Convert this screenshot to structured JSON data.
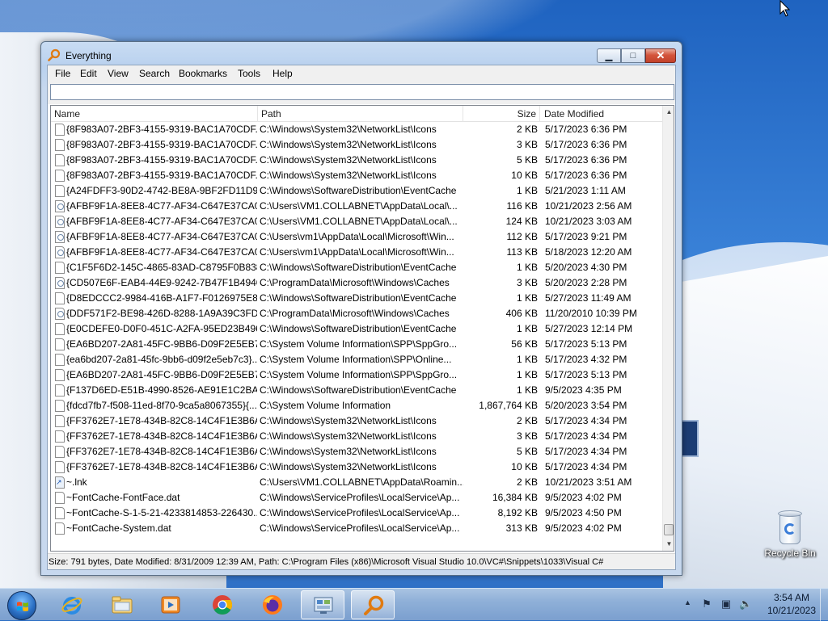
{
  "window": {
    "title": "Everything",
    "caption": {
      "minimize": "▁",
      "maximize": "□",
      "close": "✕"
    }
  },
  "menu": [
    "File",
    "Edit",
    "View",
    "Search",
    "Bookmarks",
    "Tools",
    "Help"
  ],
  "search": {
    "value": "",
    "placeholder": ""
  },
  "columns": {
    "name": "Name",
    "path": "Path",
    "size": "Size",
    "date": "Date Modified"
  },
  "rows": [
    {
      "icon": "file-icon",
      "name": "{8F983A07-2BF3-4155-9319-BAC1A70CDF...",
      "path": "C:\\Windows\\System32\\NetworkList\\Icons",
      "size": "2 KB",
      "date": "5/17/2023 6:36 PM"
    },
    {
      "icon": "file-icon",
      "name": "{8F983A07-2BF3-4155-9319-BAC1A70CDF...",
      "path": "C:\\Windows\\System32\\NetworkList\\Icons",
      "size": "3 KB",
      "date": "5/17/2023 6:36 PM"
    },
    {
      "icon": "file-icon",
      "name": "{8F983A07-2BF3-4155-9319-BAC1A70CDF...",
      "path": "C:\\Windows\\System32\\NetworkList\\Icons",
      "size": "5 KB",
      "date": "5/17/2023 6:36 PM"
    },
    {
      "icon": "file-icon",
      "name": "{8F983A07-2BF3-4155-9319-BAC1A70CDF...",
      "path": "C:\\Windows\\System32\\NetworkList\\Icons",
      "size": "10 KB",
      "date": "5/17/2023 6:36 PM"
    },
    {
      "icon": "file-icon",
      "name": "{A24FDFF3-90D2-4742-BE8A-9BF2FD11D9...",
      "path": "C:\\Windows\\SoftwareDistribution\\EventCache",
      "size": "1 KB",
      "date": "5/21/2023 1:11 AM"
    },
    {
      "icon": "image-file-icon",
      "name": "{AFBF9F1A-8EE8-4C77-AF34-C647E37CA0...",
      "path": "C:\\Users\\VM1.COLLABNET\\AppData\\Local\\...",
      "size": "116 KB",
      "date": "10/21/2023 2:56 AM"
    },
    {
      "icon": "image-file-icon",
      "name": "{AFBF9F1A-8EE8-4C77-AF34-C647E37CA0...",
      "path": "C:\\Users\\VM1.COLLABNET\\AppData\\Local\\...",
      "size": "124 KB",
      "date": "10/21/2023 3:03 AM"
    },
    {
      "icon": "image-file-icon",
      "name": "{AFBF9F1A-8EE8-4C77-AF34-C647E37CA0...",
      "path": "C:\\Users\\vm1\\AppData\\Local\\Microsoft\\Win...",
      "size": "112 KB",
      "date": "5/17/2023 9:21 PM"
    },
    {
      "icon": "image-file-icon",
      "name": "{AFBF9F1A-8EE8-4C77-AF34-C647E37CA0...",
      "path": "C:\\Users\\vm1\\AppData\\Local\\Microsoft\\Win...",
      "size": "113 KB",
      "date": "5/18/2023 12:20 AM"
    },
    {
      "icon": "file-icon",
      "name": "{C1F5F6D2-145C-4865-83AD-C8795F0B838...",
      "path": "C:\\Windows\\SoftwareDistribution\\EventCache",
      "size": "1 KB",
      "date": "5/20/2023 4:30 PM"
    },
    {
      "icon": "image-file-icon",
      "name": "{CD507E6F-EAB4-44E9-9242-7B47F1B4940...",
      "path": "C:\\ProgramData\\Microsoft\\Windows\\Caches",
      "size": "3 KB",
      "date": "5/20/2023 2:28 PM"
    },
    {
      "icon": "file-icon",
      "name": "{D8EDCCC2-9984-416B-A1F7-F0126975E8F...",
      "path": "C:\\Windows\\SoftwareDistribution\\EventCache",
      "size": "1 KB",
      "date": "5/27/2023 11:49 AM"
    },
    {
      "icon": "image-file-icon",
      "name": "{DDF571F2-BE98-426D-8288-1A9A39C3FD...",
      "path": "C:\\ProgramData\\Microsoft\\Windows\\Caches",
      "size": "406 KB",
      "date": "11/20/2010 10:39 PM"
    },
    {
      "icon": "file-icon",
      "name": "{E0CDEFE0-D0F0-451C-A2FA-95ED23B496...",
      "path": "C:\\Windows\\SoftwareDistribution\\EventCache",
      "size": "1 KB",
      "date": "5/27/2023 12:14 PM"
    },
    {
      "icon": "file-icon",
      "name": "{EA6BD207-2A81-45FC-9BB6-D09F2E5EB7...",
      "path": "C:\\System Volume Information\\SPP\\SppGro...",
      "size": "56 KB",
      "date": "5/17/2023 5:13 PM"
    },
    {
      "icon": "file-icon",
      "name": "{ea6bd207-2a81-45fc-9bb6-d09f2e5eb7c3}...",
      "path": "C:\\System Volume Information\\SPP\\Online...",
      "size": "1 KB",
      "date": "5/17/2023 4:32 PM"
    },
    {
      "icon": "file-icon",
      "name": "{EA6BD207-2A81-45FC-9BB6-D09F2E5EB7...",
      "path": "C:\\System Volume Information\\SPP\\SppGro...",
      "size": "1 KB",
      "date": "5/17/2023 5:13 PM"
    },
    {
      "icon": "file-icon",
      "name": "{F137D6ED-E51B-4990-8526-AE91E1C2BA4...",
      "path": "C:\\Windows\\SoftwareDistribution\\EventCache",
      "size": "1 KB",
      "date": "9/5/2023 4:35 PM"
    },
    {
      "icon": "file-icon",
      "name": "{fdcd7fb7-f508-11ed-8f70-9ca5a8067355}{...",
      "path": "C:\\System Volume Information",
      "size": "1,867,764 KB",
      "date": "5/20/2023 3:54 PM"
    },
    {
      "icon": "file-icon",
      "name": "{FF3762E7-1E78-434B-82C8-14C4F1E3B6A...",
      "path": "C:\\Windows\\System32\\NetworkList\\Icons",
      "size": "2 KB",
      "date": "5/17/2023 4:34 PM"
    },
    {
      "icon": "file-icon",
      "name": "{FF3762E7-1E78-434B-82C8-14C4F1E3B6A...",
      "path": "C:\\Windows\\System32\\NetworkList\\Icons",
      "size": "3 KB",
      "date": "5/17/2023 4:34 PM"
    },
    {
      "icon": "file-icon",
      "name": "{FF3762E7-1E78-434B-82C8-14C4F1E3B6A...",
      "path": "C:\\Windows\\System32\\NetworkList\\Icons",
      "size": "5 KB",
      "date": "5/17/2023 4:34 PM"
    },
    {
      "icon": "file-icon",
      "name": "{FF3762E7-1E78-434B-82C8-14C4F1E3B6A...",
      "path": "C:\\Windows\\System32\\NetworkList\\Icons",
      "size": "10 KB",
      "date": "5/17/2023 4:34 PM"
    },
    {
      "icon": "shortcut-icon",
      "name": "~.lnk",
      "path": "C:\\Users\\VM1.COLLABNET\\AppData\\Roamin...",
      "size": "2 KB",
      "date": "10/21/2023 3:51 AM"
    },
    {
      "icon": "file-icon",
      "name": "~FontCache-FontFace.dat",
      "path": "C:\\Windows\\ServiceProfiles\\LocalService\\Ap...",
      "size": "16,384 KB",
      "date": "9/5/2023 4:02 PM"
    },
    {
      "icon": "file-icon",
      "name": "~FontCache-S-1-5-21-4233814853-226430...",
      "path": "C:\\Windows\\ServiceProfiles\\LocalService\\Ap...",
      "size": "8,192 KB",
      "date": "9/5/2023 4:50 PM"
    },
    {
      "icon": "file-icon",
      "name": "~FontCache-System.dat",
      "path": "C:\\Windows\\ServiceProfiles\\LocalService\\Ap...",
      "size": "313 KB",
      "date": "9/5/2023 4:02 PM"
    }
  ],
  "status": "Size: 791 bytes, Date Modified: 8/31/2009 12:39 AM, Path: C:\\Program Files (x86)\\Microsoft Visual Studio 10.0\\VC#\\Snippets\\1033\\Visual C#",
  "scrollbar": {
    "position": 0.97
  },
  "desktop": {
    "recycle_bin_label": "Recycle Bin"
  },
  "taskbar": {
    "items": [
      "start-orb",
      "internet-explorer-icon",
      "file-explorer-icon",
      "media-player-icon",
      "chrome-icon",
      "firefox-icon",
      "control-panel-icon",
      "everything-search-icon"
    ],
    "active_item": "everything-search-icon"
  },
  "clock": {
    "time": "3:54 AM",
    "date": "10/21/2023"
  },
  "colors": {
    "accent": "#3a82d8",
    "close_button": "#c2412a",
    "taskbar": "#8fb0d8"
  }
}
